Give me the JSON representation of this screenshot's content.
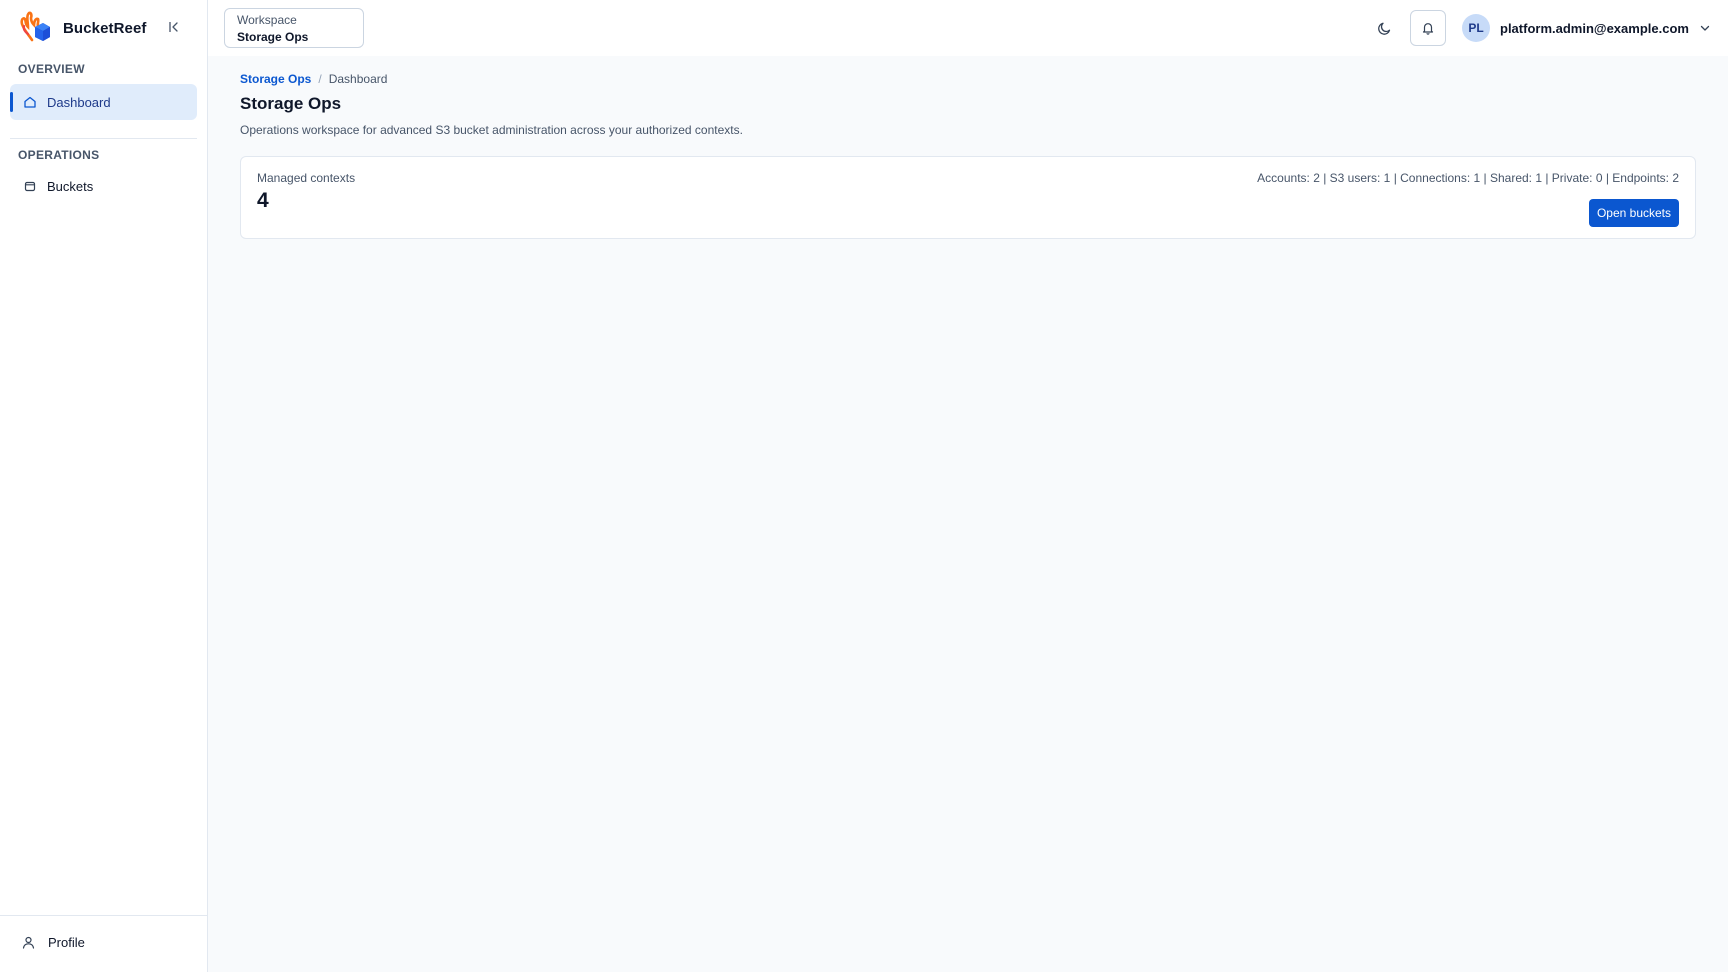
{
  "brand": {
    "name": "BucketReef"
  },
  "sidebar": {
    "sections": [
      {
        "title": "OVERVIEW",
        "items": [
          {
            "label": "Dashboard",
            "icon": "home-icon",
            "active": true
          }
        ]
      },
      {
        "title": "OPERATIONS",
        "items": [
          {
            "label": "Buckets",
            "icon": "bucket-icon",
            "active": false
          }
        ]
      }
    ],
    "footer": {
      "label": "Profile",
      "icon": "user-icon"
    }
  },
  "topbar": {
    "workspace": {
      "label": "Workspace",
      "value": "Storage Ops"
    },
    "user": {
      "initials": "PL",
      "email": "platform.admin@example.com"
    }
  },
  "breadcrumb": {
    "parent": "Storage Ops",
    "separator": "/",
    "current": "Dashboard"
  },
  "page": {
    "title": "Storage Ops",
    "description": "Operations workspace for advanced S3 bucket administration across your authorized contexts."
  },
  "card": {
    "label": "Managed contexts",
    "value": "4",
    "stats": "Accounts: 2 | S3 users: 1 | Connections: 1 | Shared: 1 | Private: 0 | Endpoints: 2",
    "button_label": "Open buckets"
  },
  "colors": {
    "accent": "#0b57d0",
    "active_bg": "#e0ecfb",
    "page_bg": "#f8fafc"
  }
}
